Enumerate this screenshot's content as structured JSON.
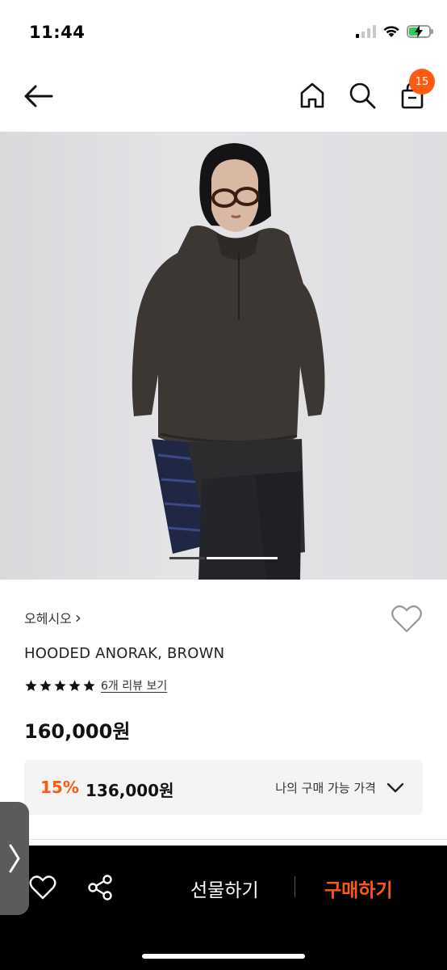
{
  "status_bar": {
    "time": "11:44",
    "icons": [
      "signal-icon",
      "wifi-icon",
      "battery-charging-icon"
    ]
  },
  "nav": {
    "back_icon": "arrow-left-icon",
    "home_icon": "home-icon",
    "search_icon": "search-icon",
    "cart_icon": "shopping-bag-icon",
    "cart_count": "15"
  },
  "product": {
    "image_icon": "product-photo",
    "image_page": 1,
    "image_total": 3,
    "brand": "오헤시오",
    "brand_chevron": "›",
    "name": "HOODED ANORAK, BROWN",
    "rating": 5,
    "review_link": "6개 리뷰 보기",
    "price": "160,000원",
    "discount": {
      "rate": "15%",
      "price": "136,000원",
      "label": "나의 구매 가능 가격"
    }
  },
  "bottom_bar": {
    "gift_label": "선물하기",
    "buy_label": "구매하기"
  },
  "colors": {
    "accent": "#ff5a12",
    "bottom_bar_bg": "#000000",
    "discount_box_bg": "#f4f4f5"
  }
}
